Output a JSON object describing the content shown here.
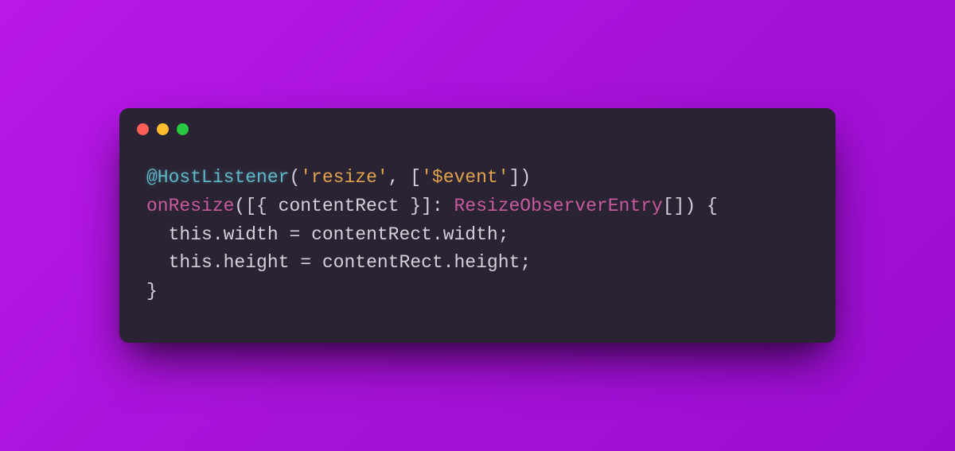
{
  "traffic_lights": {
    "red": "#ff5f57",
    "yellow": "#febc2e",
    "green": "#28c840"
  },
  "code": {
    "line1": {
      "decorator": "@HostListener",
      "open": "(",
      "arg1": "'resize'",
      "sep": ", [",
      "arg2": "'$event'",
      "close": "])"
    },
    "line2": {
      "fn": "onResize",
      "params_open": "([{ ",
      "param": "contentRect",
      "params_mid": " }]: ",
      "type": "ResizeObserverEntry",
      "arr": "[]",
      "params_close": ") {"
    },
    "line3": {
      "indent": "  ",
      "lhs": "this.width",
      "eq": " = ",
      "rhs": "contentRect.width",
      "semi": ";"
    },
    "line4": {
      "indent": "  ",
      "lhs": "this.height",
      "eq": " = ",
      "rhs": "contentRect.height",
      "semi": ";"
    },
    "line5": {
      "close": "}"
    }
  }
}
